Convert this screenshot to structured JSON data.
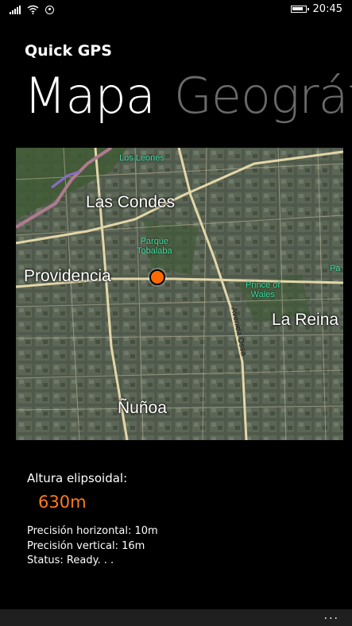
{
  "status_bar": {
    "time": "20:45"
  },
  "app": {
    "title": "Quick GPS"
  },
  "pivot": {
    "active": "Mapa",
    "next": "Geográf"
  },
  "map": {
    "labels": {
      "los_leones": "Los Leones",
      "las_condes": "Las Condes",
      "parque_tobalaba": [
        "Parque",
        "Tobalaba"
      ],
      "providencia": "Providencia",
      "prince_of_wales": [
        "Prince of",
        "Wales"
      ],
      "la_reina": "La Reina",
      "avenida_ossa": "Avenida Ossa",
      "nunoa": "Ñuñoa",
      "edge_pa": "Pa"
    },
    "marker_color": "#ff6a00"
  },
  "altitude": {
    "label": "Altura elipsoidal:",
    "value": "630m",
    "value_color": "#ff7a1a"
  },
  "info": {
    "horizontal": "Precisión horizontal: 10m",
    "vertical": "Precisión vertical: 16m",
    "status": "Status: Ready. . ."
  },
  "appbar": {
    "more": "..."
  }
}
